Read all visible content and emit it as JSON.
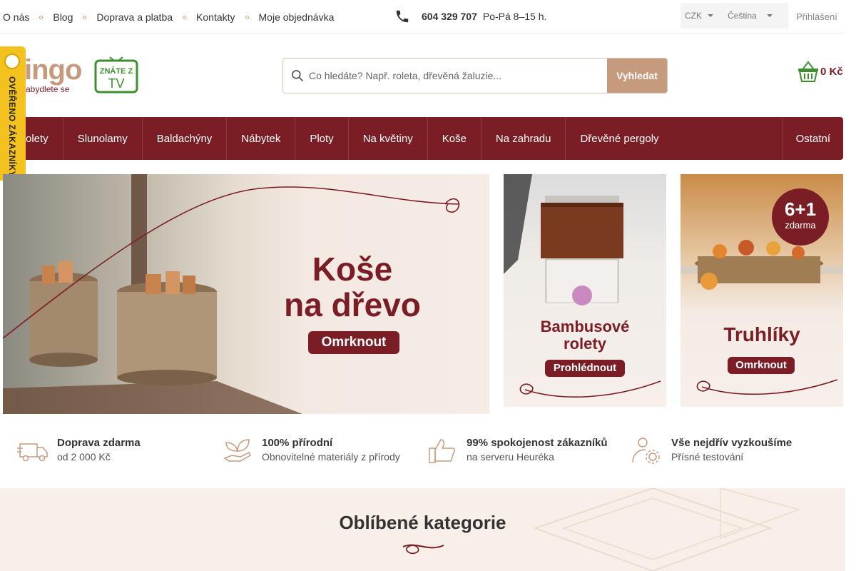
{
  "topbar": {
    "links": [
      "O nás",
      "Blog",
      "Doprava a platba",
      "Kontakty",
      "Moje objednávka"
    ],
    "phone": "604 329 707",
    "hours": "Po-Pá 8–15 h.",
    "currency": "CZK",
    "language": "Čeština",
    "login": "Přihlášení"
  },
  "header": {
    "brand": "ingo",
    "tagline": "abydlete se",
    "tv_badge_line1": "ZNÁTE Z",
    "tv_badge_line2": "TV",
    "search_placeholder": "Co hledáte? Např. roleta, dřevěná žaluzie...",
    "search_button": "Vyhledat",
    "cart_total": "0 Kč"
  },
  "sidetab": {
    "text": "OVĚŘENO ZÁKAZNÍKY"
  },
  "nav": {
    "items": [
      "olety",
      "Slunolamy",
      "Baldachýny",
      "Nábytek",
      "Ploty",
      "Na květiny",
      "Koše",
      "Na zahradu",
      "Dřevěné pergoly"
    ],
    "other": "Ostatní"
  },
  "banners": {
    "main": {
      "line1": "Koše",
      "line2": "na dřevo",
      "button": "Omrknout"
    },
    "side1": {
      "line1": "Bambusové",
      "line2": "rolety",
      "button": "Prohlédnout"
    },
    "side2": {
      "badge_big": "6+1",
      "badge_small": "zdarma",
      "title": "Truhlíky",
      "button": "Omrknout"
    }
  },
  "features": [
    {
      "icon": "truck-icon",
      "title": "Doprava zdarma",
      "subtitle": "od 2 000 Kč"
    },
    {
      "icon": "leaf-hand-icon",
      "title": "100% přírodní",
      "subtitle": "Obnovitelné materiály z přírody"
    },
    {
      "icon": "thumbs-up-icon",
      "title": "99% spokojenost zákazníků",
      "subtitle": "na serveru Heuréka"
    },
    {
      "icon": "user-gear-icon",
      "title": "Vše nejdřív vyzkoušíme",
      "subtitle": "Přísné testování"
    }
  ],
  "popular": {
    "title": "Oblíbené kategorie"
  },
  "colors": {
    "burgundy": "#7a1d25",
    "tan": "#c69a7c",
    "cream": "#f7efe8",
    "gold": "#f4c21f"
  }
}
